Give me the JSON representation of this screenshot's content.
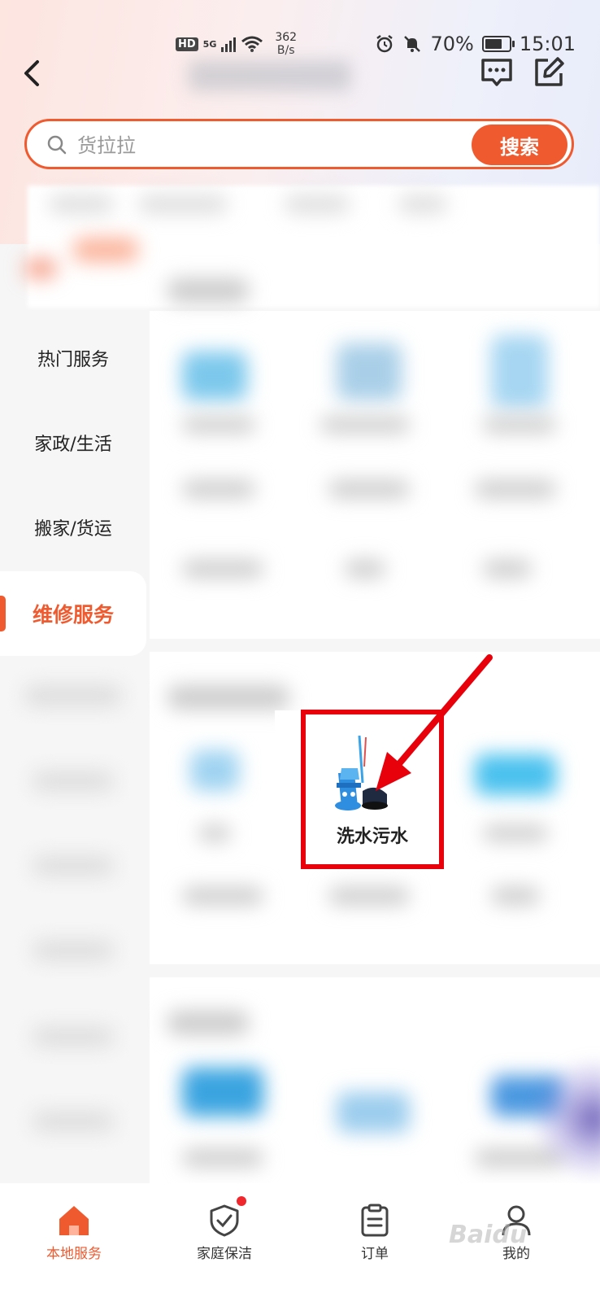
{
  "status_bar": {
    "hd": "HD",
    "network": "5G",
    "speed_value": "362",
    "speed_unit": "B/s",
    "battery": "70%",
    "battery_level": 0.7,
    "time": "15:01"
  },
  "search": {
    "placeholder": "货拉拉",
    "button_label": "搜索"
  },
  "sidebar": {
    "items": [
      {
        "label": "热门服务"
      },
      {
        "label": "家政/生活"
      },
      {
        "label": "搬家/货运"
      },
      {
        "label": "维修服务"
      }
    ]
  },
  "highlight": {
    "label": "洗水污水"
  },
  "tabs": [
    {
      "label": "本地服务"
    },
    {
      "label": "家庭保洁"
    },
    {
      "label": "订单"
    },
    {
      "label": "我的"
    }
  ],
  "watermark": "Baidu",
  "colors": {
    "accent": "#f05a2f",
    "highlight_box": "#e8000b",
    "tab_badge": "#f0282d"
  }
}
